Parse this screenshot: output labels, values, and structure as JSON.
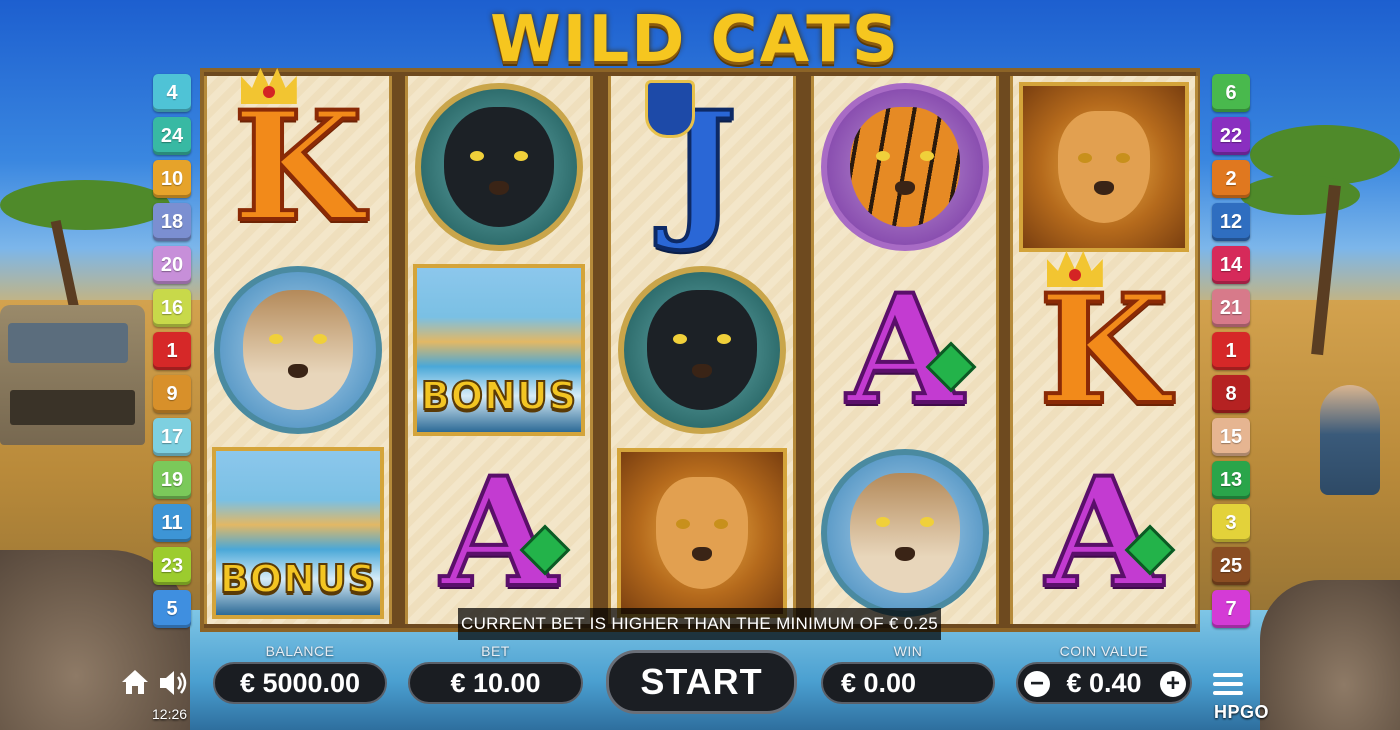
{
  "game": {
    "title": "WILD CATS",
    "brand": "HPGO",
    "clock": "12:26",
    "message": "CURRENT BET IS HIGHER THAN THE MINIMUM OF € 0.25"
  },
  "paylines_left": [
    {
      "n": "4",
      "color": "#4fc3d6"
    },
    {
      "n": "24",
      "color": "#38b9a3"
    },
    {
      "n": "10",
      "color": "#e6a32a"
    },
    {
      "n": "18",
      "color": "#7b8fd1"
    },
    {
      "n": "20",
      "color": "#c78fd9"
    },
    {
      "n": "16",
      "color": "#c8d94a"
    },
    {
      "n": "1",
      "color": "#d62828"
    },
    {
      "n": "9",
      "color": "#d8902a"
    },
    {
      "n": "17",
      "color": "#7ed0e0"
    },
    {
      "n": "19",
      "color": "#7bc95a"
    },
    {
      "n": "11",
      "color": "#3d95d6"
    },
    {
      "n": "23",
      "color": "#9ccc2e"
    },
    {
      "n": "5",
      "color": "#3f8fe0"
    }
  ],
  "paylines_right": [
    {
      "n": "6",
      "color": "#49b94d"
    },
    {
      "n": "22",
      "color": "#8a2fc0"
    },
    {
      "n": "2",
      "color": "#e0781f"
    },
    {
      "n": "12",
      "color": "#2f6ec0"
    },
    {
      "n": "14",
      "color": "#d62a5a"
    },
    {
      "n": "21",
      "color": "#d77a8a"
    },
    {
      "n": "1",
      "color": "#d62828"
    },
    {
      "n": "8",
      "color": "#b52222"
    },
    {
      "n": "15",
      "color": "#e6b591"
    },
    {
      "n": "13",
      "color": "#2aa54a"
    },
    {
      "n": "3",
      "color": "#e3d23a"
    },
    {
      "n": "25",
      "color": "#8a4d22"
    },
    {
      "n": "7",
      "color": "#d43bd6"
    }
  ],
  "reels": [
    [
      {
        "type": "letter",
        "value": "K"
      },
      {
        "type": "animal",
        "animal": "lynx"
      },
      {
        "type": "bonus",
        "label": "BONUS"
      }
    ],
    [
      {
        "type": "animal",
        "animal": "panther"
      },
      {
        "type": "bonus",
        "label": "BONUS"
      },
      {
        "type": "letter",
        "value": "A"
      }
    ],
    [
      {
        "type": "letter",
        "value": "J"
      },
      {
        "type": "animal",
        "animal": "panther"
      },
      {
        "type": "lion"
      }
    ],
    [
      {
        "type": "animal",
        "animal": "tiger"
      },
      {
        "type": "letter",
        "value": "A"
      },
      {
        "type": "animal",
        "animal": "lynx"
      }
    ],
    [
      {
        "type": "lion"
      },
      {
        "type": "letter",
        "value": "K"
      },
      {
        "type": "letter",
        "value": "A"
      }
    ]
  ],
  "controls": {
    "balance_label": "BALANCE",
    "balance_value": "€ 5000.00",
    "bet_label": "BET",
    "bet_value": "€ 10.00",
    "start_label": "START",
    "win_label": "WIN",
    "win_value": "€ 0.00",
    "coin_label": "COIN VALUE",
    "coin_value": "€ 0.40",
    "minus": "−",
    "plus": "+"
  }
}
